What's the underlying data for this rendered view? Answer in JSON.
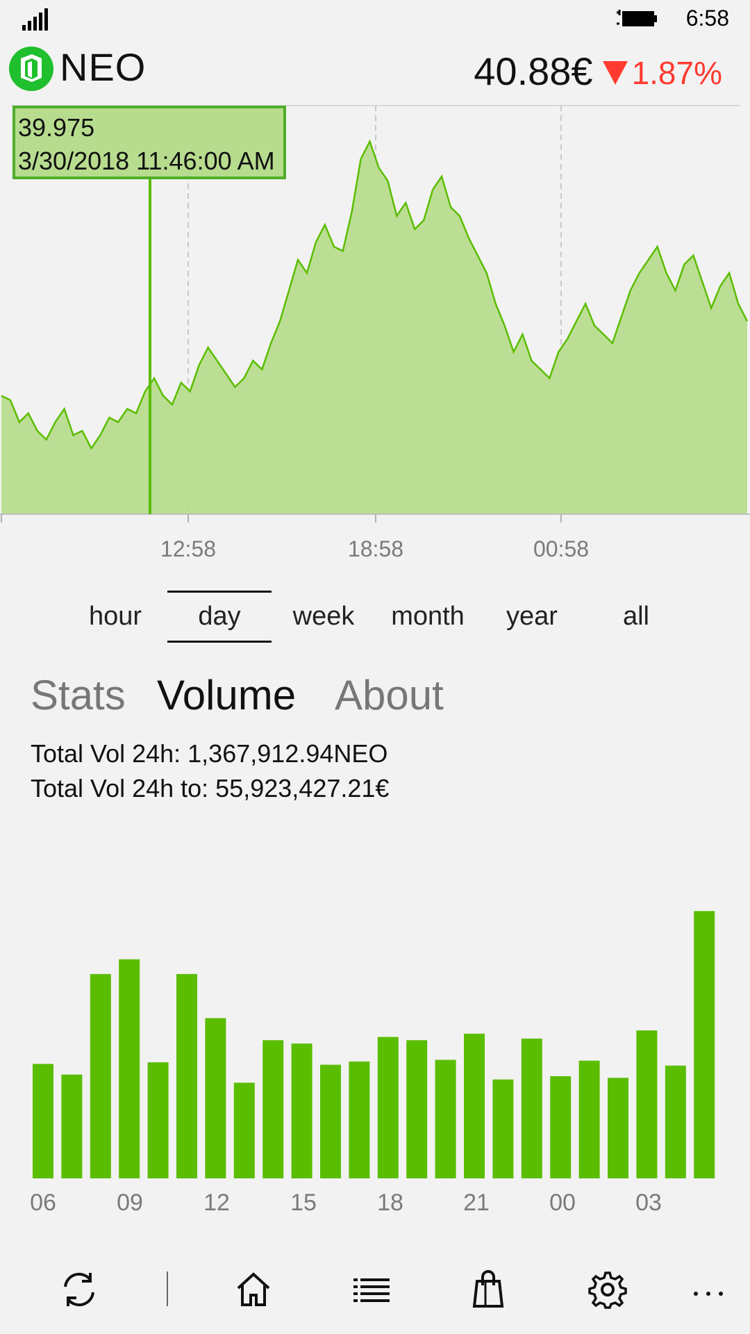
{
  "status_bar": {
    "time": "6:58",
    "signal_icon": "signal-bars-icon",
    "battery_icon": "battery-charging-icon"
  },
  "header": {
    "coin": "NEO",
    "logo_icon": "neo-logo-icon",
    "price": "40.88€",
    "change": "1.87%",
    "change_direction": "down",
    "accent_color": "#5bbd00",
    "down_color": "#ff3b30"
  },
  "price_chart": {
    "tooltip": {
      "value": "39.975",
      "timestamp": "3/30/2018 11:46:00 AM"
    },
    "x_ticks": [
      "12:58",
      "18:58",
      "00:58"
    ],
    "fill_color": "#b7dc8e",
    "line_color": "#5bbd00",
    "chart_data": {
      "type": "area",
      "series": [
        {
          "values": [
            40.2,
            40.1,
            39.6,
            39.8,
            39.4,
            39.2,
            39.6,
            39.9,
            39.3,
            39.4,
            39.0,
            39.3,
            39.7,
            39.6,
            39.9,
            39.8,
            40.3,
            40.6,
            40.2,
            40.0,
            40.5,
            40.3,
            40.9,
            41.3,
            41.0,
            40.7,
            40.4,
            40.6,
            41.0,
            40.8,
            41.4,
            41.9,
            42.6,
            43.3,
            43.0,
            43.7,
            44.1,
            43.6,
            43.5,
            44.4,
            45.6,
            46.0,
            45.4,
            45.1,
            44.3,
            44.6,
            44.0,
            44.2,
            44.9,
            45.2,
            44.5,
            44.3,
            43.8,
            43.4,
            43.0,
            42.3,
            41.8,
            41.2,
            41.6,
            41.0,
            40.8,
            40.6,
            41.2,
            41.5,
            41.9,
            42.3,
            41.8,
            41.6,
            41.4,
            42.0,
            42.6,
            43.0,
            43.3,
            43.6,
            43.0,
            42.6,
            43.2,
            43.4,
            42.8,
            42.2,
            42.7,
            43.0,
            42.3,
            41.9
          ]
        }
      ],
      "x_tick_labels": [
        "12:58",
        "18:58",
        "00:58"
      ],
      "ylim": [
        37.5,
        46.5
      ]
    }
  },
  "ranges": {
    "items": [
      "hour",
      "day",
      "week",
      "month",
      "year",
      "all"
    ],
    "selected": "day"
  },
  "pivot": {
    "items": [
      "Stats",
      "Volume",
      "About"
    ],
    "selected": "Volume"
  },
  "volume": {
    "line1": "Total Vol 24h: 1,367,912.94NEO",
    "line2": "Total Vol 24h to: 55,923,427.21€",
    "bar_color": "#5bbd00",
    "chart_data": {
      "type": "bar",
      "values": [
        140,
        127,
        250,
        268,
        142,
        250,
        196,
        117,
        169,
        165,
        139,
        143,
        173,
        169,
        145,
        177,
        121,
        171,
        125,
        144,
        123,
        181,
        138,
        327
      ],
      "x_tick_labels": [
        "06",
        "09",
        "12",
        "15",
        "18",
        "21",
        "00",
        "03"
      ],
      "ylim": [
        0,
        340
      ]
    }
  },
  "appbar": {
    "items": [
      "refresh-icon",
      "home-icon",
      "list-icon",
      "shopping-bag-icon",
      "settings-icon",
      "more-icon"
    ]
  }
}
